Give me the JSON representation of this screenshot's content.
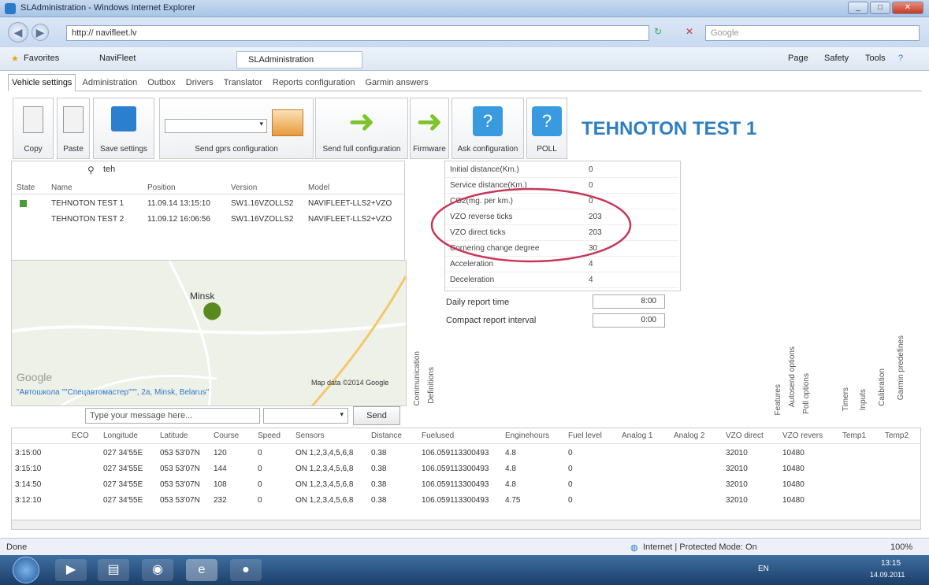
{
  "window": {
    "title": "SLAdministration - Windows Internet Explorer",
    "address": "http://           navifleet.lv",
    "search_placeholder": "Google"
  },
  "favorites": {
    "favorites_label": "Favorites",
    "tab1": "NaviFleet",
    "tab2": "SLAdministration",
    "menu": [
      "Page",
      "Safety",
      "Tools"
    ]
  },
  "app_tabs": [
    "Vehicle settings",
    "Administration",
    "Outbox",
    "Drivers",
    "Translator",
    "Reports configuration",
    "Garmin answers"
  ],
  "toolbar": {
    "copy": "Copy",
    "paste": "Paste",
    "save": "Save settings",
    "send_gprs": "Send gprs configuration",
    "send_full": "Send full configuration",
    "firmware": "Firmware",
    "ask_config": "Ask configuration",
    "poll": "POLL"
  },
  "device_title": "TEHNOTON TEST 1",
  "vehicle_search": {
    "value": "teh"
  },
  "vehicle_table": {
    "headers": [
      "State",
      "Name",
      "Position",
      "Version",
      "Model"
    ],
    "rows": [
      {
        "name": "TEHNOTON TEST 1",
        "position": "11.09.14 13:15:10",
        "version": "SW1.16VZOLLS2",
        "model": "NAVIFLEET-LLS2+VZO"
      },
      {
        "name": "TEHNOTON TEST 2",
        "position": "11.09.12 16:06:56",
        "version": "SW1.16VZOLLS2",
        "model": "NAVIFLEET-LLS2+VZO"
      }
    ]
  },
  "map": {
    "city": "Minsk",
    "address": "\"Автошкола \"\"Спецавтомастер\"\"\", 2a, Minsk, Belarus\"",
    "credit": "Map data ©2014 Google",
    "google": "Google"
  },
  "message": {
    "placeholder": "Type your message here...",
    "send": "Send"
  },
  "settings": [
    {
      "key": "Initial distance(Km.)",
      "value": "0"
    },
    {
      "key": "Service distance(Km.)",
      "value": "0"
    },
    {
      "key": "CO2(mg. per km.)",
      "value": "0"
    },
    {
      "key": "VZO reverse ticks",
      "value": "203"
    },
    {
      "key": "VZO direct ticks",
      "value": "203"
    },
    {
      "key": "Cornering change degree",
      "value": "30"
    },
    {
      "key": "Acceleration",
      "value": "4"
    },
    {
      "key": "Deceleration",
      "value": "4"
    }
  ],
  "report": {
    "daily_label": "Daily report time",
    "daily_value": "8:00",
    "compact_label": "Compact report interval",
    "compact_value": "0:00"
  },
  "side_tabs_left": [
    "Communication",
    "Definitions"
  ],
  "side_tabs_right": [
    "Features",
    "Autosend options",
    "Poll options",
    "Timers",
    "Inputs",
    "Calibration",
    "Garmin predefines"
  ],
  "grid": {
    "headers": [
      "ECO",
      "Longitude",
      "Latitude",
      "Course",
      "Speed",
      "Sensors",
      "Distance",
      "Fuelused",
      "Enginehours",
      "Fuel level",
      "Analog 1",
      "Analog 2",
      "VZO direct",
      "VZO revers",
      "Temp1",
      "Temp2"
    ],
    "rows": [
      {
        "time": "3:15:00",
        "lon": "027 34'55E",
        "lat": "053 53'07N",
        "course": "120",
        "speed": "0",
        "sensors": "ON 1,2,3,4,5,6,8",
        "dist": "0.38",
        "fuel": "106.059113300493",
        "eng": "4.8",
        "level": "0",
        "vzod": "32010",
        "vzor": "10480"
      },
      {
        "time": "3:15:10",
        "lon": "027 34'55E",
        "lat": "053 53'07N",
        "course": "144",
        "speed": "0",
        "sensors": "ON 1,2,3,4,5,6,8",
        "dist": "0.38",
        "fuel": "106.059113300493",
        "eng": "4.8",
        "level": "0",
        "vzod": "32010",
        "vzor": "10480"
      },
      {
        "time": "3:14:50",
        "lon": "027 34'55E",
        "lat": "053 53'07N",
        "course": "108",
        "speed": "0",
        "sensors": "ON 1,2,3,4,5,6,8",
        "dist": "0.38",
        "fuel": "106.059113300493",
        "eng": "4.8",
        "level": "0",
        "vzod": "32010",
        "vzor": "10480"
      },
      {
        "time": "3:12:10",
        "lon": "027 34'55E",
        "lat": "053 53'07N",
        "course": "232",
        "speed": "0",
        "sensors": "ON 1,2,3,4,5,6,8",
        "dist": "0.38",
        "fuel": "106.059113300493",
        "eng": "4.75",
        "level": "0",
        "vzod": "32010",
        "vzor": "10480"
      }
    ]
  },
  "status": {
    "left": "Done",
    "zone": "Internet | Protected Mode: On",
    "zoom": "100%"
  },
  "taskbar": {
    "lang": "EN",
    "time": "13:15",
    "date": "14.09.2011"
  }
}
